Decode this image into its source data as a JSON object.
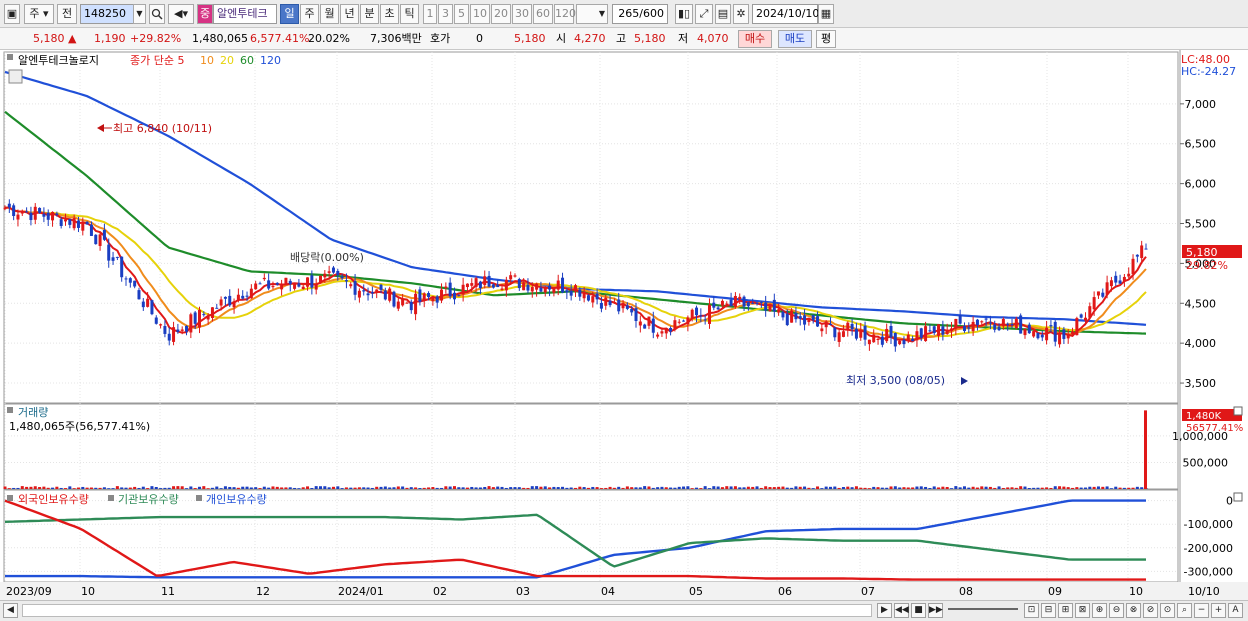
{
  "toolbar": {
    "period_type": "주",
    "prev_label": "전",
    "code": "148250",
    "badge": "중",
    "stock_name": "알엔투테크",
    "tabs": [
      "일",
      "주",
      "월",
      "년",
      "분",
      "초",
      "틱"
    ],
    "active_tab": "일",
    "intervals": [
      "1",
      "3",
      "5",
      "10",
      "20",
      "30",
      "60",
      "120"
    ],
    "count": "265",
    "count_total": "/600",
    "date": "2024/10/10"
  },
  "quote": {
    "price": "5,180",
    "change": "1,190",
    "change_pct": "+29.82%",
    "volume": "1,480,065",
    "volume_ratio": "6,577.41%",
    "turnover": "20.02%",
    "amount": "7,306백만",
    "hoga_label": "호가",
    "hoga_value": "0",
    "bid": "5,180",
    "open_label": "시",
    "open": "4,270",
    "high_label": "고",
    "high": "5,180",
    "low_label": "저",
    "low": "4,070",
    "buy_label": "매수",
    "sell_label": "매도",
    "eval_label": "평"
  },
  "price_panel": {
    "stock_label": "알엔투테크놀로지",
    "ma_label": "종가 단순 5",
    "ma_periods": [
      "10",
      "20",
      "60",
      "120"
    ],
    "lc": "LC:48.00",
    "hc": "HC:-24.27",
    "high_annot": "최고 6,840 (10/11)",
    "low_annot": "최저 3,500 (08/05)",
    "dividend_annot": "배당락(0.00%)",
    "last_price_badge": "5,180",
    "last_pct_badge": "29.82%"
  },
  "volume_panel": {
    "title": "거래량",
    "value": "1,480,065주(56,577.41%)",
    "badge_top": "1,480K",
    "badge_bottom": "56577.41%"
  },
  "holdings_panel": {
    "legend": [
      "외국인보유수량",
      "기관보유수량",
      "개인보유수량"
    ]
  },
  "x_labels": [
    "2023/09",
    "10",
    "11",
    "12",
    "2024/01",
    "02",
    "03",
    "04",
    "05",
    "06",
    "07",
    "08",
    "09",
    "10"
  ],
  "x_right": "10/10",
  "colors": {
    "ma5": "#e01818",
    "ma10": "#f08c1c",
    "ma20": "#e6d20a",
    "ma60": "#1e8c2a",
    "ma120": "#2050d8",
    "foreign": "#2050d8",
    "institution": "#2e8b57",
    "individual": "#e01818"
  },
  "chart_data": [
    {
      "type": "line",
      "title": "알엔투테크놀로지 일봉",
      "x": [
        "2023/09",
        "10",
        "11",
        "12",
        "2024/01",
        "02",
        "03",
        "04",
        "05",
        "06",
        "07",
        "08",
        "09",
        "10"
      ],
      "y_ticks": [
        7000,
        6500,
        6000,
        5500,
        5000,
        4500,
        4000,
        3500
      ],
      "ylim": [
        3250,
        7650
      ],
      "series": [
        {
          "name": "종가",
          "values": [
            5700,
            5500,
            4100,
            4700,
            4800,
            4500,
            4800,
            4700,
            4200,
            4500,
            4200,
            4050,
            4300,
            4100,
            5180
          ]
        },
        {
          "name": "MA60",
          "values": [
            6900,
            6100,
            5200,
            4900,
            4850,
            4750,
            4600,
            4650,
            4550,
            4450,
            4350,
            4250,
            4200,
            4150,
            4120
          ]
        },
        {
          "name": "MA120",
          "values": [
            7400,
            7100,
            6600,
            6000,
            5300,
            4950,
            4800,
            4680,
            4650,
            4550,
            4450,
            4400,
            4330,
            4300,
            4230
          ]
        }
      ]
    },
    {
      "type": "bar",
      "title": "거래량",
      "y_ticks": [
        1000000,
        500000
      ],
      "ylim": [
        0,
        1600000
      ],
      "values": [
        1480065
      ]
    },
    {
      "type": "line",
      "title": "보유수량",
      "y_ticks": [
        0,
        -100000,
        -200000,
        -300000
      ],
      "ylim": [
        -345000,
        45000
      ],
      "series": [
        {
          "name": "외국인보유수량",
          "values": [
            -320000,
            -320000,
            -325000,
            -325000,
            -325000,
            -325000,
            -325000,
            -325000,
            -230000,
            -200000,
            -130000,
            -120000,
            -120000,
            -60000,
            0,
            0
          ]
        },
        {
          "name": "기관보유수량",
          "values": [
            -90000,
            -80000,
            -70000,
            -70000,
            -70000,
            -70000,
            -80000,
            -60000,
            -280000,
            -180000,
            -160000,
            -170000,
            -170000,
            -210000,
            -250000,
            -250000
          ]
        },
        {
          "name": "개인보유수량",
          "values": [
            0,
            -120000,
            -320000,
            -260000,
            -310000,
            -270000,
            -250000,
            -320000,
            -320000,
            -320000,
            -330000,
            -330000,
            -335000,
            -335000,
            -335000,
            -335000
          ]
        }
      ]
    }
  ]
}
